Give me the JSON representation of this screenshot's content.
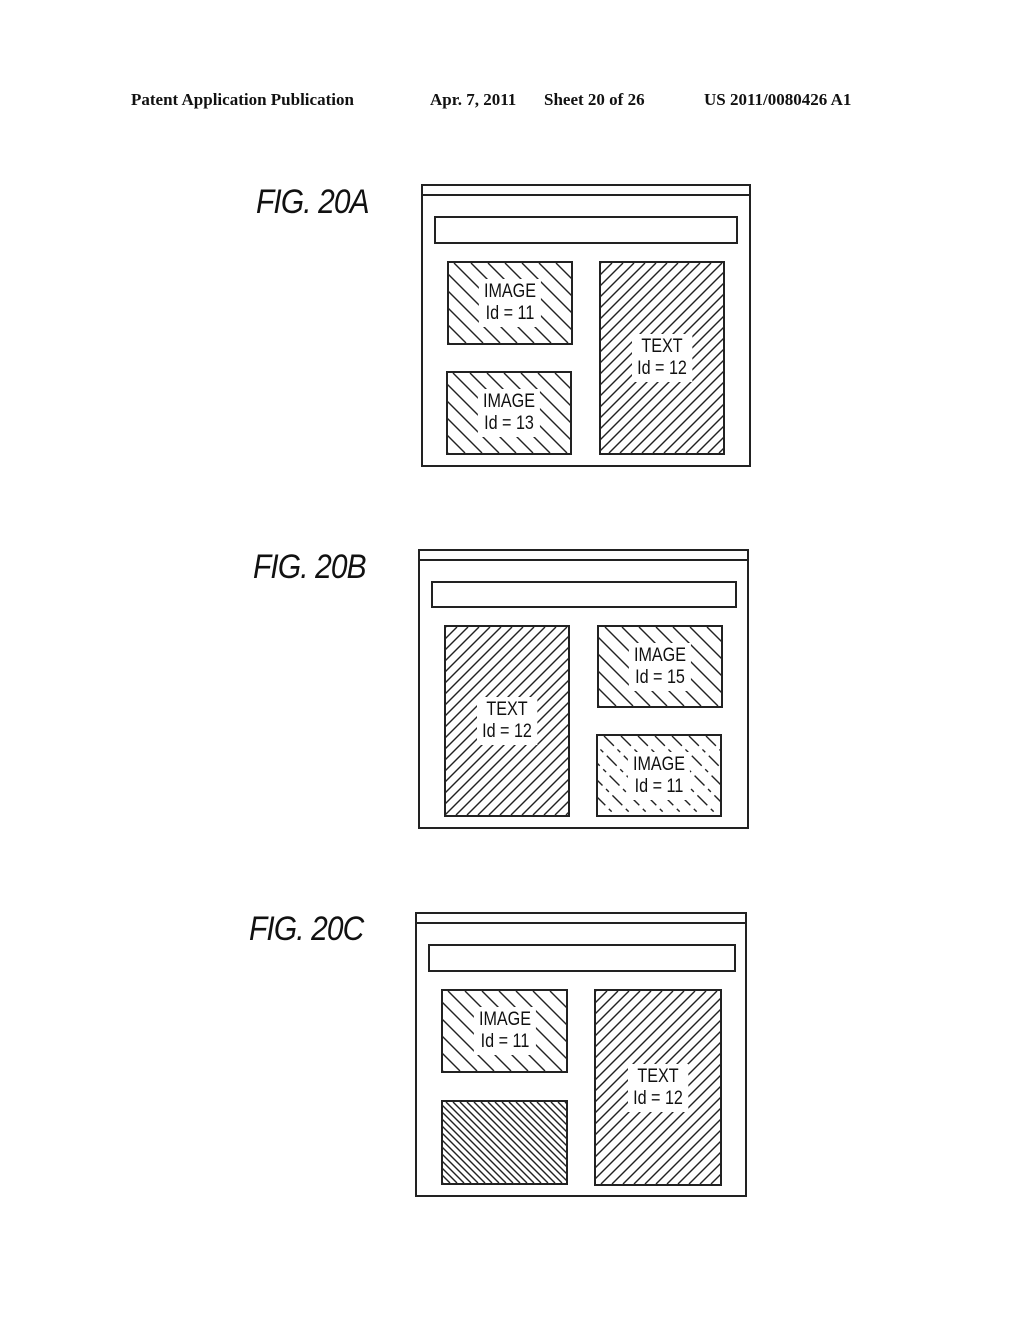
{
  "header": {
    "publication": "Patent Application Publication",
    "date": "Apr. 7, 2011",
    "sheet": "Sheet 20 of 26",
    "number": "US 2011/0080426 A1"
  },
  "figures": [
    {
      "label": "FIG. 20A",
      "boxes": [
        {
          "type": "IMAGE",
          "id_text": "Id = 11",
          "hatch": "back"
        },
        {
          "type": "TEXT",
          "id_text": "Id = 12",
          "hatch": "forward"
        },
        {
          "type": "IMAGE",
          "id_text": "Id = 13",
          "hatch": "back"
        }
      ]
    },
    {
      "label": "FIG. 20B",
      "boxes": [
        {
          "type": "TEXT",
          "id_text": "Id = 12",
          "hatch": "forward"
        },
        {
          "type": "IMAGE",
          "id_text": "Id = 15",
          "hatch": "back"
        },
        {
          "type": "IMAGE",
          "id_text": "Id = 11",
          "hatch": "back-dashed"
        }
      ]
    },
    {
      "label": "FIG. 20C",
      "boxes": [
        {
          "type": "IMAGE",
          "id_text": "Id = 11",
          "hatch": "back"
        },
        {
          "type": "TEXT",
          "id_text": "Id = 12",
          "hatch": "forward"
        },
        {
          "type": "",
          "id_text": "",
          "hatch": "back-dense"
        }
      ]
    }
  ]
}
